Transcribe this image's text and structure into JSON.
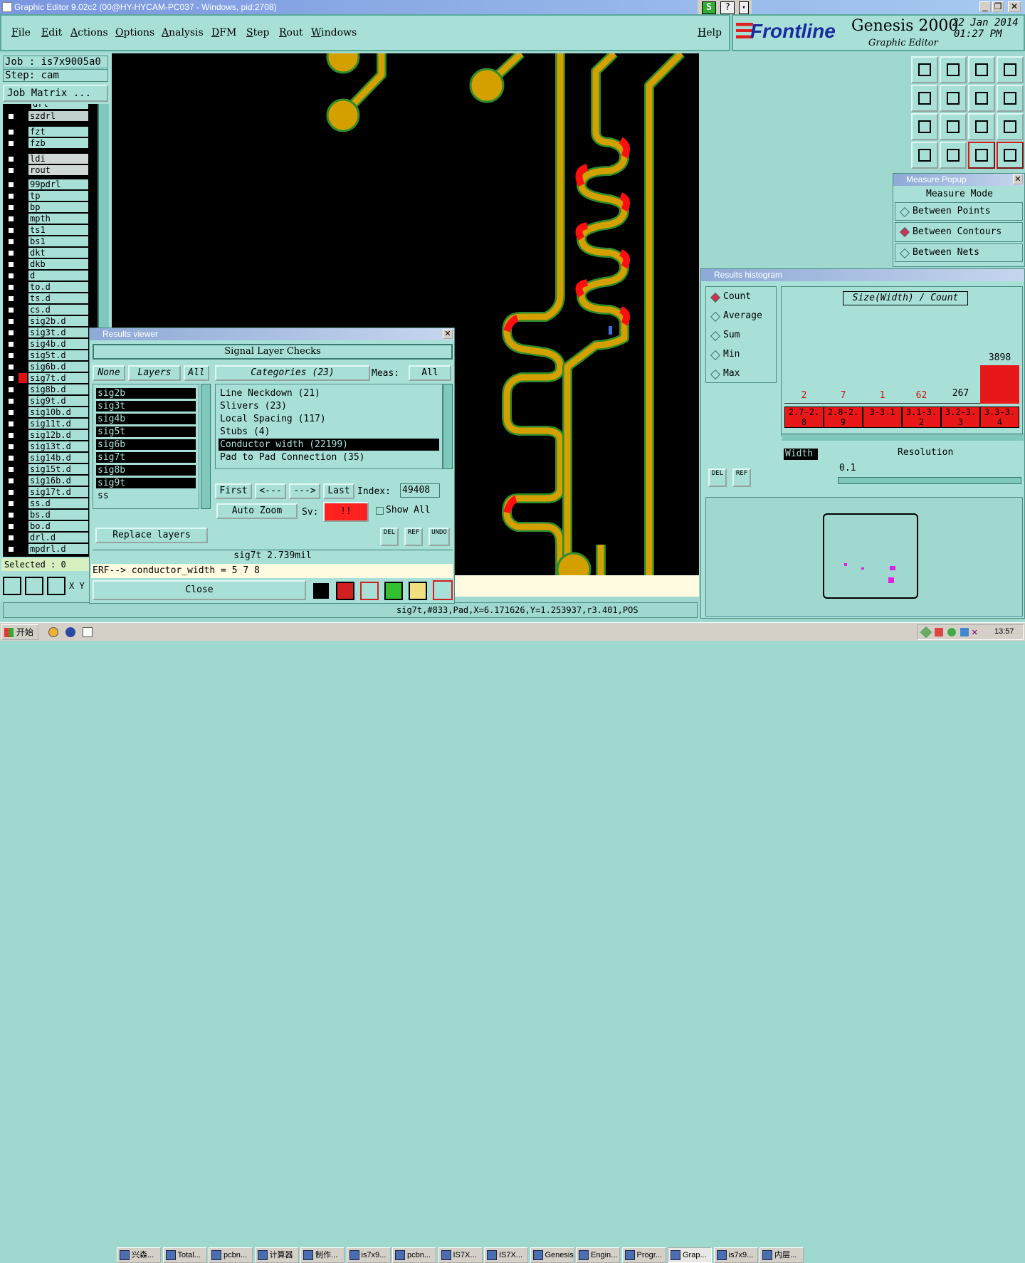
{
  "window": {
    "title": "Graphic Editor 9.02c2 (00@HY-HYCAM-PC037 - Windows, pid:2708)"
  },
  "menu": [
    "File",
    "Edit",
    "Actions",
    "Options",
    "Analysis",
    "DFM",
    "Step",
    "Rout",
    "Windows"
  ],
  "help": "Help",
  "logo": {
    "brand": "Frontline",
    "product": "Genesis 2000",
    "subtitle": "Graphic Editor",
    "date": "22 Jan 2014",
    "time": "01:27 PM"
  },
  "job": {
    "job_label": "Job  :  is7x9005a0",
    "step_label": "Step: cam",
    "matrix_button": "Job Matrix ..."
  },
  "layers_top": [
    "szdrl",
    "fzt",
    "fzb",
    "ldi",
    "rout"
  ],
  "layers": [
    "99pdrl",
    "tp",
    "bp",
    "mpth",
    "ts1",
    "bs1",
    "dkt",
    "dkb",
    "d",
    "to.d",
    "ts.d",
    "cs.d",
    "sig2b.d",
    "sig3t.d",
    "sig4b.d",
    "sig5t.d",
    "sig6b.d",
    "sig7t.d",
    "sig8b.d",
    "sig9t.d",
    "sig10b.d",
    "sig11t.d",
    "sig12b.d",
    "sig13t.d",
    "sig14b.d",
    "sig15t.d",
    "sig16b.d",
    "sig17t.d",
    "ss.d",
    "bs.d",
    "bo.d",
    "drl.d",
    "mpdrl.d"
  ],
  "partial_layer": "drl",
  "selected": "Selected : 0",
  "xy_label": "X Y",
  "status_line": "sig7t,#833,Pad,X=6.171626,Y=1.253937,r3.401,POS",
  "results_viewer": {
    "title": "Results viewer",
    "header": "Signal Layer Checks",
    "none": "None",
    "layers": "Layers",
    "all": "All",
    "layer_list": [
      "sig2b",
      "sig3t",
      "sig4b",
      "sig5t",
      "sig6b",
      "sig7t",
      "sig8b",
      "sig9t",
      "ss"
    ],
    "categories_label": "Categories (23)",
    "meas_label": "Meas:",
    "meas_value": "All",
    "categories": [
      "Line Neckdown (21)",
      "Slivers (23)",
      "Local Spacing (117)",
      "Stubs (4)",
      "Conductor width (22199)",
      "Pad to Pad Connection (35)"
    ],
    "selected_category": "Conductor width (22199)",
    "first": "First",
    "prev": "<---",
    "next": "--->",
    "last": "Last",
    "index_label": "Index:",
    "index_value": "49408",
    "auto_zoom": "Auto Zoom",
    "sv_label": "Sv:",
    "sv_value": "!!",
    "show_all": "Show All",
    "replace_layers": "Replace layers",
    "del": "DEL",
    "ref": "REF",
    "undo": "UNDO",
    "measure_text": "sig7t 2.739mil",
    "erf_text": "ERF--> conductor_width = 5 7 8",
    "close": "Close"
  },
  "measure_popup": {
    "title": "Measure Popup",
    "mode": "Measure Mode",
    "options": [
      "Between Points",
      "Between Contours",
      "Between Nets"
    ],
    "selected": "Between Contours"
  },
  "histogram": {
    "title": "Results histogram",
    "options": [
      "Count",
      "Average",
      "Sum",
      "Min",
      "Max"
    ],
    "selected": "Count",
    "chart_title": "Size(Width) / Count",
    "bars": [
      {
        "label": "2.7-2.8",
        "value": 2
      },
      {
        "label": "2.8-2.9",
        "value": 7
      },
      {
        "label": "3-3.1",
        "value": 1
      },
      {
        "label": "3.1-3.2",
        "value": 62
      },
      {
        "label": "3.2-3.3",
        "value": 267
      },
      {
        "label": "3.3-3.4",
        "value": 3898
      }
    ],
    "width_label": "Width",
    "resolution_label": "Resolution",
    "resolution_value": "0.1",
    "del": "DEL",
    "ref": "REF"
  },
  "taskbar": {
    "start": "开始",
    "tasks": [
      "兴森...",
      "Total...",
      "pcbn...",
      "计算器",
      "制作...",
      "is7x9...",
      "pcbn...",
      "IS7X...",
      "IS7X...",
      "Genesis",
      "Engin...",
      "Progr...",
      "Grap...",
      "is7x9...",
      "内层..."
    ],
    "clock": "13:57"
  },
  "colors": {
    "panel": "#a8e0d8",
    "trace": "#d4a000",
    "trace_edge": "#2e8b2e",
    "error": "#ff1010",
    "bar": "#e81818"
  }
}
